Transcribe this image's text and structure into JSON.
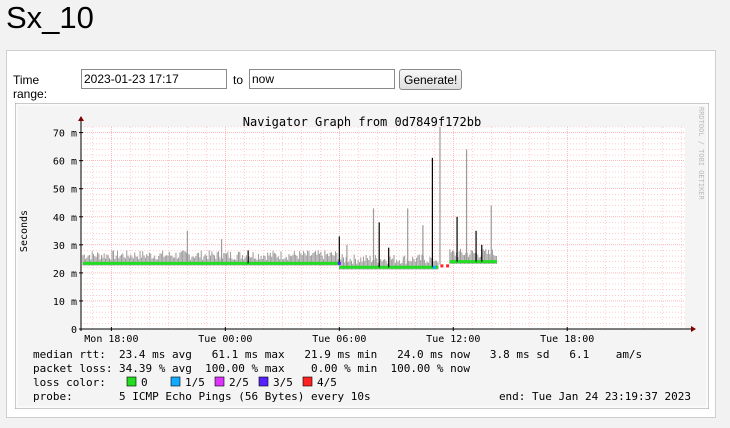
{
  "page": {
    "title": "Sx_10"
  },
  "range": {
    "label": "Time range:",
    "from_value": "2023-01-23 17:17",
    "to_label": "to",
    "to_value": "now",
    "button": "Generate!"
  },
  "colors": {
    "loss_0": "#22dd22",
    "loss_1": "#11aaff",
    "loss_2": "#dd33ff",
    "loss_3": "#5522ff",
    "loss_4": "#ff2222",
    "smoke": "#9a9a9a",
    "grid": "#ffb0b0"
  },
  "chart_data": {
    "type": "line",
    "title": "Navigator Graph from 0d7849f172bb",
    "ylabel": "Seconds",
    "watermark": "RRDTOOL / TOBI OETIKER",
    "ylim": [
      0,
      72
    ],
    "yticks": [
      0,
      10,
      20,
      30,
      40,
      50,
      60,
      70
    ],
    "ytick_labels": [
      "0",
      "10 m",
      "20 m",
      "30 m",
      "40 m",
      "50 m",
      "60 m",
      "70 m"
    ],
    "xlim_hours": [
      -1.6,
      30.2
    ],
    "xtick_labels": [
      "Mon 18:00",
      "Tue 00:00",
      "Tue 06:00",
      "Tue 12:00",
      "Tue 18:00"
    ],
    "xtick_hours": [
      0,
      6,
      12,
      18,
      24
    ],
    "median_series": [
      {
        "x": [
          -1.5,
          12.0
        ],
        "y": [
          23.4,
          23.4
        ],
        "loss": "0/5"
      },
      {
        "x": [
          12.0,
          17.2
        ],
        "y": [
          22.0,
          22.0
        ],
        "loss": "0/5"
      },
      {
        "x": [
          17.8,
          20.3
        ],
        "y": [
          24.0,
          24.0
        ],
        "loss": "0/5"
      }
    ],
    "spikes": [
      {
        "x": 7.2,
        "y": 28
      },
      {
        "x": 12.0,
        "y": 33
      },
      {
        "x": 14.1,
        "y": 38
      },
      {
        "x": 14.6,
        "y": 29
      },
      {
        "x": 16.9,
        "y": 61
      },
      {
        "x": 18.2,
        "y": 40
      },
      {
        "x": 19.2,
        "y": 35
      },
      {
        "x": 19.5,
        "y": 30
      }
    ],
    "smoke_peaks": [
      {
        "x": 4.0,
        "y": 35
      },
      {
        "x": 5.8,
        "y": 32
      },
      {
        "x": 12.4,
        "y": 30
      },
      {
        "x": 13.8,
        "y": 43
      },
      {
        "x": 15.6,
        "y": 43
      },
      {
        "x": 16.4,
        "y": 37
      },
      {
        "x": 17.3,
        "y": 72
      },
      {
        "x": 18.7,
        "y": 64
      },
      {
        "x": 20.0,
        "y": 44
      }
    ],
    "loss_markers": [
      {
        "x": 12.0,
        "loss": "3/5"
      },
      {
        "x": 17.0,
        "loss": "1/5"
      },
      {
        "x": 17.4,
        "loss": "4/5"
      },
      {
        "x": 17.7,
        "loss": "4/5"
      }
    ],
    "stats": {
      "median_label": "median rtt:",
      "median_values": "23.4 ms avg   61.1 ms max   21.9 ms min   24.0 ms now   3.8 ms sd   6.1    am/s",
      "loss_label": "packet loss:",
      "loss_values": "34.39 % avg  100.00 % max    0.00 % min  100.00 % now",
      "legend_label": "loss color:",
      "legend_items": [
        "0",
        "1/5",
        "2/5",
        "3/5",
        "4/5"
      ],
      "probe_label": "probe:",
      "probe_value": "5 ICMP Echo Pings (56 Bytes) every 10s",
      "end_value": "end: Tue Jan 24 23:19:37 2023"
    }
  }
}
